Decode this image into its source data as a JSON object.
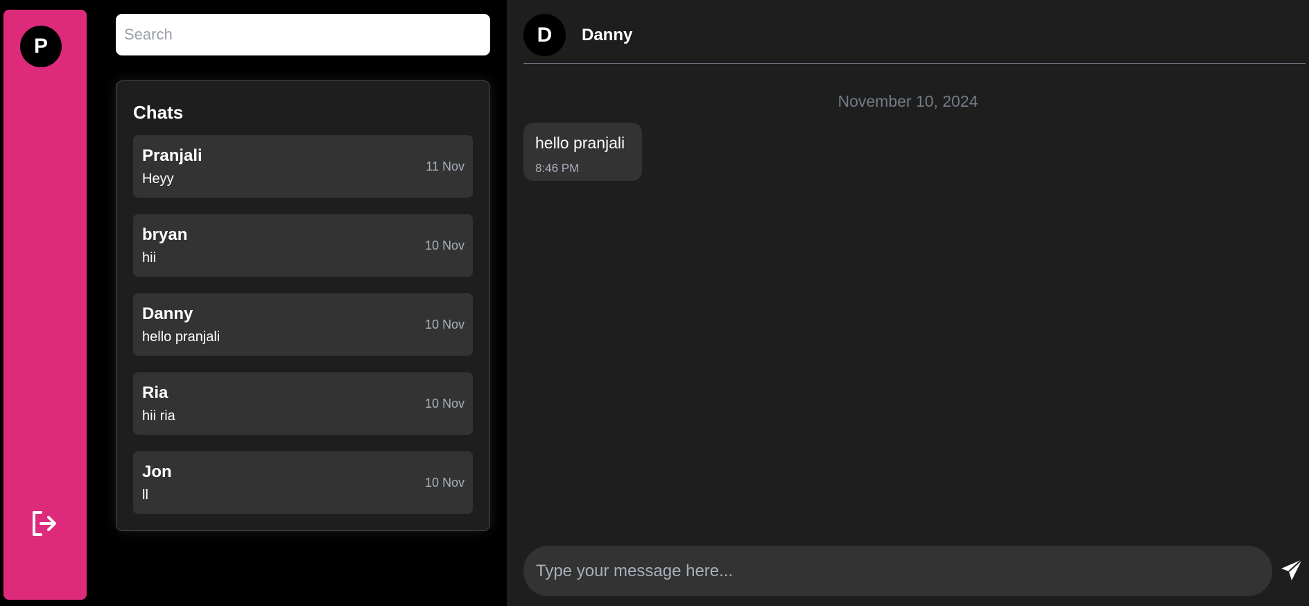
{
  "sidebar": {
    "avatar_letter": "P",
    "logout_icon": "logout-icon",
    "accent_color": "#dd2a7b"
  },
  "search": {
    "placeholder": "Search",
    "value": ""
  },
  "chats": {
    "title": "Chats",
    "items": [
      {
        "name": "Pranjali",
        "preview": "Heyy",
        "date": "11 Nov"
      },
      {
        "name": "bryan",
        "preview": "hii",
        "date": "10 Nov"
      },
      {
        "name": "Danny",
        "preview": "hello pranjali",
        "date": "10 Nov"
      },
      {
        "name": "Ria",
        "preview": "hii ria",
        "date": "10 Nov"
      },
      {
        "name": "Jon",
        "preview": "ll",
        "date": "10 Nov"
      }
    ]
  },
  "conversation": {
    "avatar_letter": "D",
    "contact_name": "Danny",
    "date_separator": "November 10, 2024",
    "messages": [
      {
        "text": "hello pranjali",
        "time": "8:46 PM"
      }
    ],
    "input": {
      "placeholder": "Type your message here...",
      "value": ""
    },
    "send_icon": "send-icon"
  }
}
